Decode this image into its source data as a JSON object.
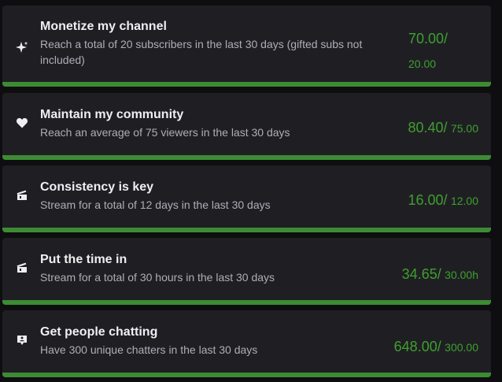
{
  "accent_color": "#3d8b34",
  "goals": [
    {
      "icon": "sparkle-icon",
      "title": "Monetize my channel",
      "description": "Reach a total of 20 subscribers in the last 30 days (gifted subs not included)",
      "current": "70.00/",
      "target": "20.00",
      "progress": 1.0
    },
    {
      "icon": "heart-icon",
      "title": "Maintain my community",
      "description": "Reach an average of 75 viewers in the last 30 days",
      "current": "80.40/",
      "target": "75.00",
      "progress": 1.0
    },
    {
      "icon": "clapperboard-icon",
      "title": "Consistency is key",
      "description": "Stream for a total of 12 days in the last 30 days",
      "current": "16.00/",
      "target": "12.00",
      "progress": 1.0
    },
    {
      "icon": "clapperboard-icon",
      "title": "Put the time in",
      "description": "Stream for a total of 30 hours in the last 30 days",
      "current": "34.65/",
      "target": "30.00h",
      "progress": 1.0
    },
    {
      "icon": "chat-bubble-icon",
      "title": "Get people chatting",
      "description": "Have 300 unique chatters in the last 30 days",
      "current": "648.00/",
      "target": "300.00",
      "progress": 1.0
    }
  ]
}
